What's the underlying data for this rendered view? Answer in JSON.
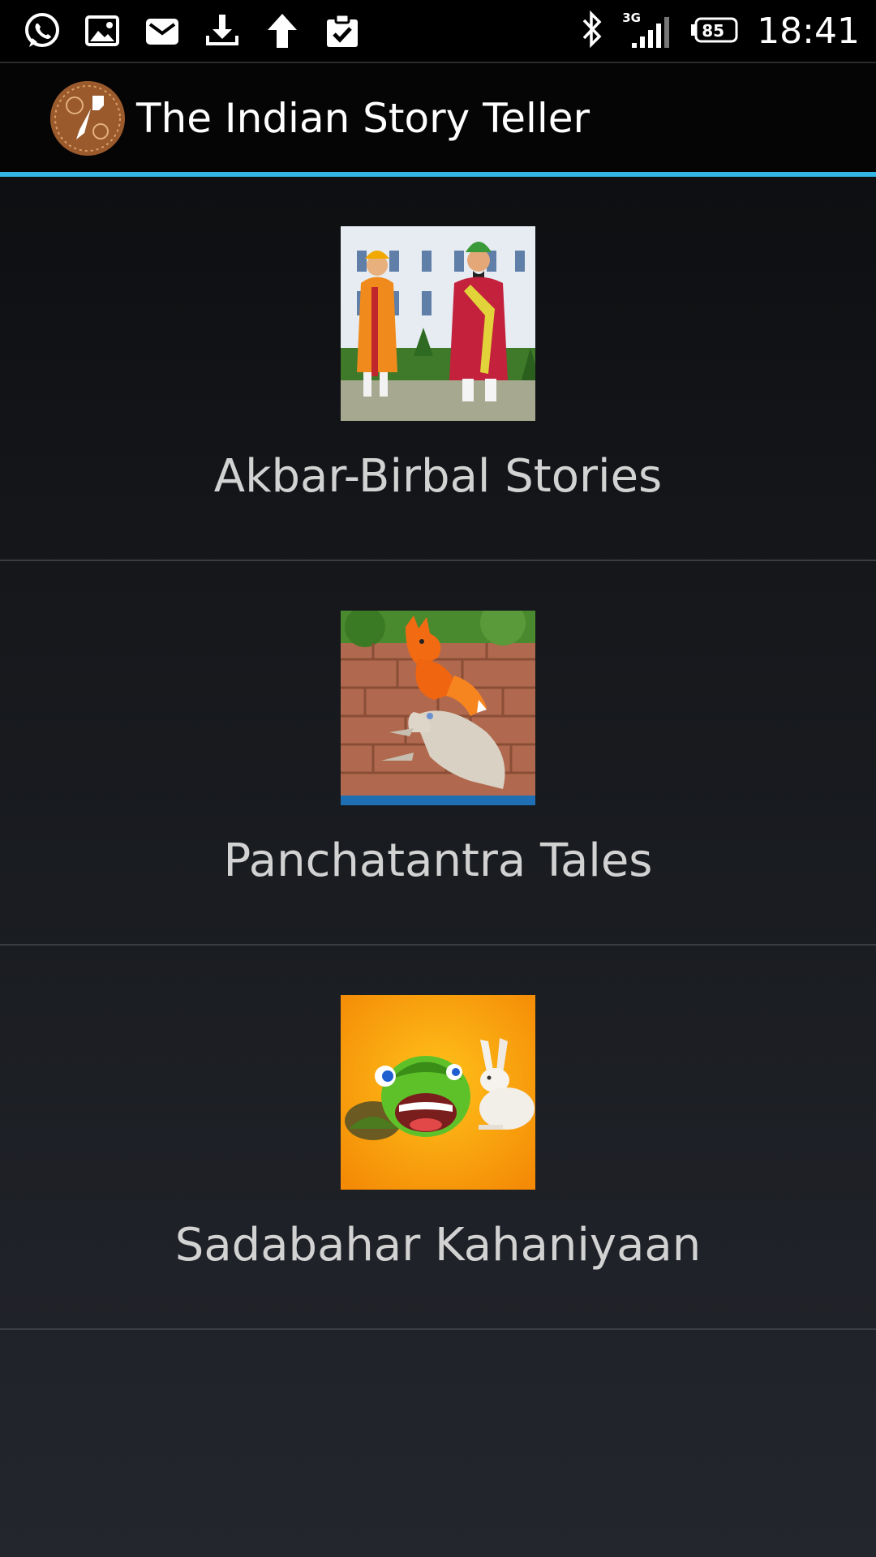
{
  "status_bar": {
    "time": "18:41",
    "battery_level": "85",
    "network": "3G",
    "left_icons": [
      "whatsapp-icon",
      "image-icon",
      "mail-icon",
      "download-icon",
      "upload-icon",
      "clipboard-check-icon"
    ],
    "right_icons": [
      "bluetooth-icon",
      "signal-icon",
      "battery-icon"
    ]
  },
  "action_bar": {
    "title": "The Indian Story Teller",
    "logo_icon": "app-logo-icon"
  },
  "colors": {
    "accent": "#33b5e5",
    "background_top": "#0a0b0d",
    "background_bottom": "#23262d",
    "text": "#d2d2d2"
  },
  "stories": [
    {
      "label": "Akbar-Birbal Stories",
      "image": "akbar-birbal-illustration"
    },
    {
      "label": "Panchatantra Tales",
      "image": "fox-and-goat-illustration"
    },
    {
      "label": "Sadabahar Kahaniyaan",
      "image": "tortoise-and-hare-illustration"
    }
  ]
}
